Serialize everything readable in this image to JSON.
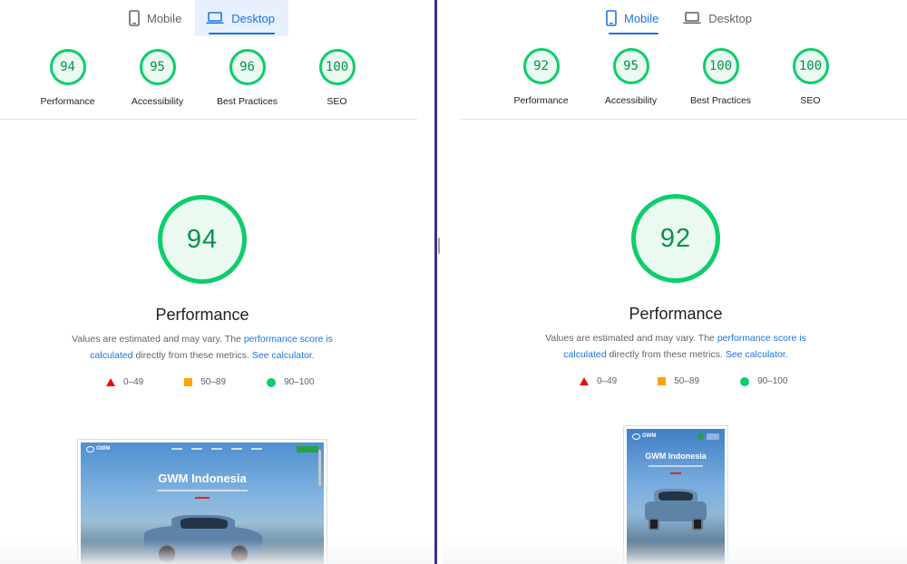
{
  "left": {
    "tabs": [
      {
        "label": "Mobile",
        "icon": "phone-icon",
        "active": false
      },
      {
        "label": "Desktop",
        "icon": "laptop-icon",
        "active": true
      }
    ],
    "gauges": [
      {
        "score": "94",
        "label": "Performance"
      },
      {
        "score": "95",
        "label": "Accessibility"
      },
      {
        "score": "96",
        "label": "Best Practices"
      },
      {
        "score": "100",
        "label": "SEO"
      }
    ],
    "main_score": "94",
    "main_title": "Performance",
    "screenshot_title": "GWM Indonesia"
  },
  "right": {
    "tabs": [
      {
        "label": "Mobile",
        "icon": "phone-icon",
        "active": true
      },
      {
        "label": "Desktop",
        "icon": "laptop-icon",
        "active": false
      }
    ],
    "gauges": [
      {
        "score": "92",
        "label": "Performance"
      },
      {
        "score": "95",
        "label": "Accessibility"
      },
      {
        "score": "100",
        "label": "Best Practices"
      },
      {
        "score": "100",
        "label": "SEO"
      }
    ],
    "main_score": "92",
    "main_title": "Performance",
    "screenshot_title": "GWM Indonesia"
  },
  "description": {
    "part1": "Values are estimated and may vary. The ",
    "link1": "performance score is calculated",
    "part2": " directly from these metrics. ",
    "link2": "See calculator."
  },
  "legend": {
    "fail": "0–49",
    "average": "50–89",
    "pass": "90–100"
  },
  "colors": {
    "pass": "#0cce6b",
    "average": "#ffa400",
    "fail": "#eb0f00",
    "accent": "#1a73e8",
    "divider": "#3b2f8f"
  }
}
